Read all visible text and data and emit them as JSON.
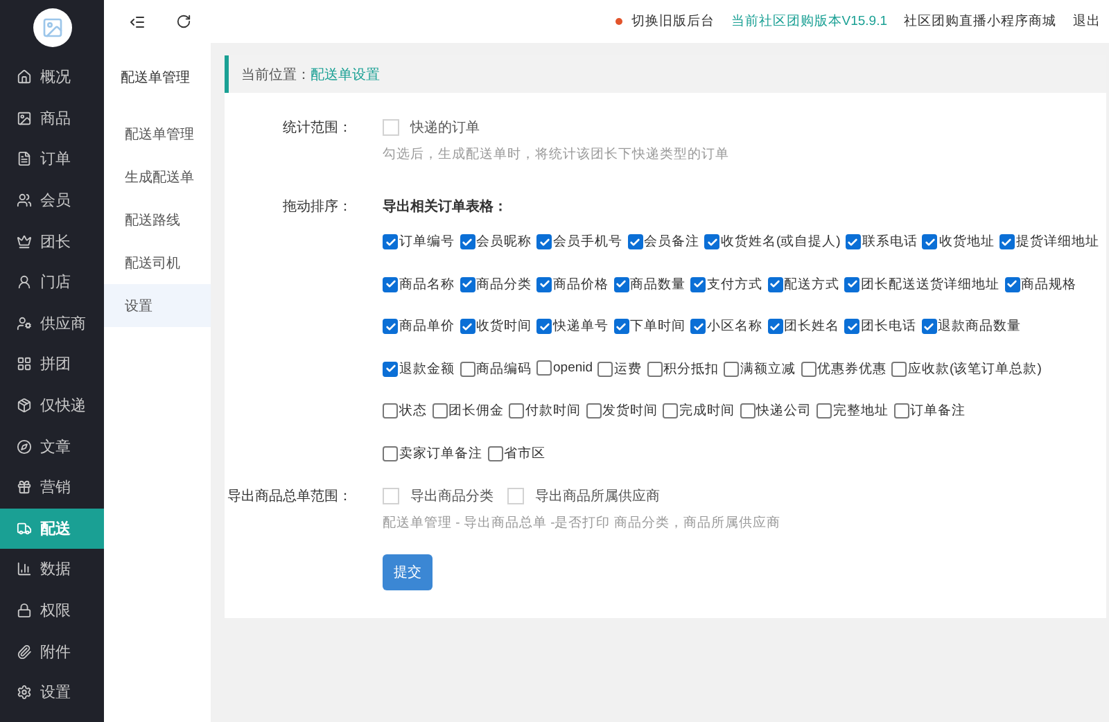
{
  "sidebar": {
    "items": [
      {
        "label": "概况",
        "selected": false
      },
      {
        "label": "商品",
        "selected": false
      },
      {
        "label": "订单",
        "selected": false
      },
      {
        "label": "会员",
        "selected": false
      },
      {
        "label": "团长",
        "selected": false
      },
      {
        "label": "门店",
        "selected": false
      },
      {
        "label": "供应商",
        "selected": false
      },
      {
        "label": "拼团",
        "selected": false
      },
      {
        "label": "仅快递",
        "selected": false
      },
      {
        "label": "文章",
        "selected": false
      },
      {
        "label": "营销",
        "selected": false
      },
      {
        "label": "配送",
        "selected": true
      },
      {
        "label": "数据",
        "selected": false
      },
      {
        "label": "权限",
        "selected": false
      },
      {
        "label": "附件",
        "selected": false
      },
      {
        "label": "设置",
        "selected": false
      }
    ]
  },
  "subnav": {
    "title": "配送单管理",
    "items": [
      {
        "label": "配送单管理",
        "selected": false
      },
      {
        "label": "生成配送单",
        "selected": false
      },
      {
        "label": "配送路线",
        "selected": false
      },
      {
        "label": "配送司机",
        "selected": false
      },
      {
        "label": "设置",
        "selected": true
      }
    ]
  },
  "topbar": {
    "links": [
      {
        "label": "切换旧版后台",
        "kind": "dot"
      },
      {
        "label": "当前社区团购版本V15.9.1",
        "kind": "accent"
      },
      {
        "label": "社区团购直播小程序商城",
        "kind": "plain"
      },
      {
        "label": "退出",
        "kind": "plain"
      }
    ]
  },
  "breadcrumb": {
    "prefix": "当前位置：",
    "current": "配送单设置"
  },
  "form": {
    "scope": {
      "label": "统计范围：",
      "option": {
        "label": "快递的订单",
        "checked": false
      },
      "hint": "勾选后，生成配送单时，将统计该团长下快递类型的订单"
    },
    "sort": {
      "label": "拖动排序：",
      "heading": "导出相关订单表格：",
      "rows": [
        [
          {
            "label": "订单编号",
            "checked": true
          },
          {
            "label": "会员昵称",
            "checked": true
          },
          {
            "label": "会员手机号",
            "checked": true
          },
          {
            "label": "会员备注",
            "checked": true
          },
          {
            "label": "收货姓名(或自提人)",
            "checked": true
          },
          {
            "label": "联系电话",
            "checked": true
          },
          {
            "label": "收货地址",
            "checked": true
          },
          {
            "label": "提货详细地址",
            "checked": true
          }
        ],
        [
          {
            "label": "商品名称",
            "checked": true
          },
          {
            "label": "商品分类",
            "checked": true
          },
          {
            "label": "商品价格",
            "checked": true
          },
          {
            "label": "商品数量",
            "checked": true
          },
          {
            "label": "支付方式",
            "checked": true
          },
          {
            "label": "配送方式",
            "checked": true
          },
          {
            "label": "团长配送送货详细地址",
            "checked": true
          },
          {
            "label": "商品规格",
            "checked": true
          }
        ],
        [
          {
            "label": "商品单价",
            "checked": true
          },
          {
            "label": "收货时间",
            "checked": true
          },
          {
            "label": "快递单号",
            "checked": true
          },
          {
            "label": "下单时间",
            "checked": true
          },
          {
            "label": "小区名称",
            "checked": true
          },
          {
            "label": "团长姓名",
            "checked": true
          },
          {
            "label": "团长电话",
            "checked": true
          },
          {
            "label": "退款商品数量",
            "checked": true
          }
        ],
        [
          {
            "label": "退款金额",
            "checked": true
          },
          {
            "label": "商品编码",
            "checked": false
          },
          {
            "label": "openid",
            "checked": false
          },
          {
            "label": "运费",
            "checked": false
          },
          {
            "label": "积分抵扣",
            "checked": false
          },
          {
            "label": "满额立减",
            "checked": false
          },
          {
            "label": "优惠券优惠",
            "checked": false
          },
          {
            "label": "应收款(该笔订单总款)",
            "checked": false
          }
        ],
        [
          {
            "label": "状态",
            "checked": false
          },
          {
            "label": "团长佣金",
            "checked": false
          },
          {
            "label": "付款时间",
            "checked": false
          },
          {
            "label": "发货时间",
            "checked": false
          },
          {
            "label": "完成时间",
            "checked": false
          },
          {
            "label": "快递公司",
            "checked": false
          },
          {
            "label": "完整地址",
            "checked": false
          },
          {
            "label": "订单备注",
            "checked": false
          }
        ],
        [
          {
            "label": "卖家订单备注",
            "checked": false
          },
          {
            "label": "省市区",
            "checked": false
          }
        ]
      ]
    },
    "summary": {
      "label": "导出商品总单范围：",
      "options": [
        {
          "label": "导出商品分类",
          "checked": false
        },
        {
          "label": "导出商品所属供应商",
          "checked": false
        }
      ],
      "hint": "配送单管理 - 导出商品总单 -是否打印 商品分类，商品所属供应商"
    },
    "submit": "提交"
  }
}
